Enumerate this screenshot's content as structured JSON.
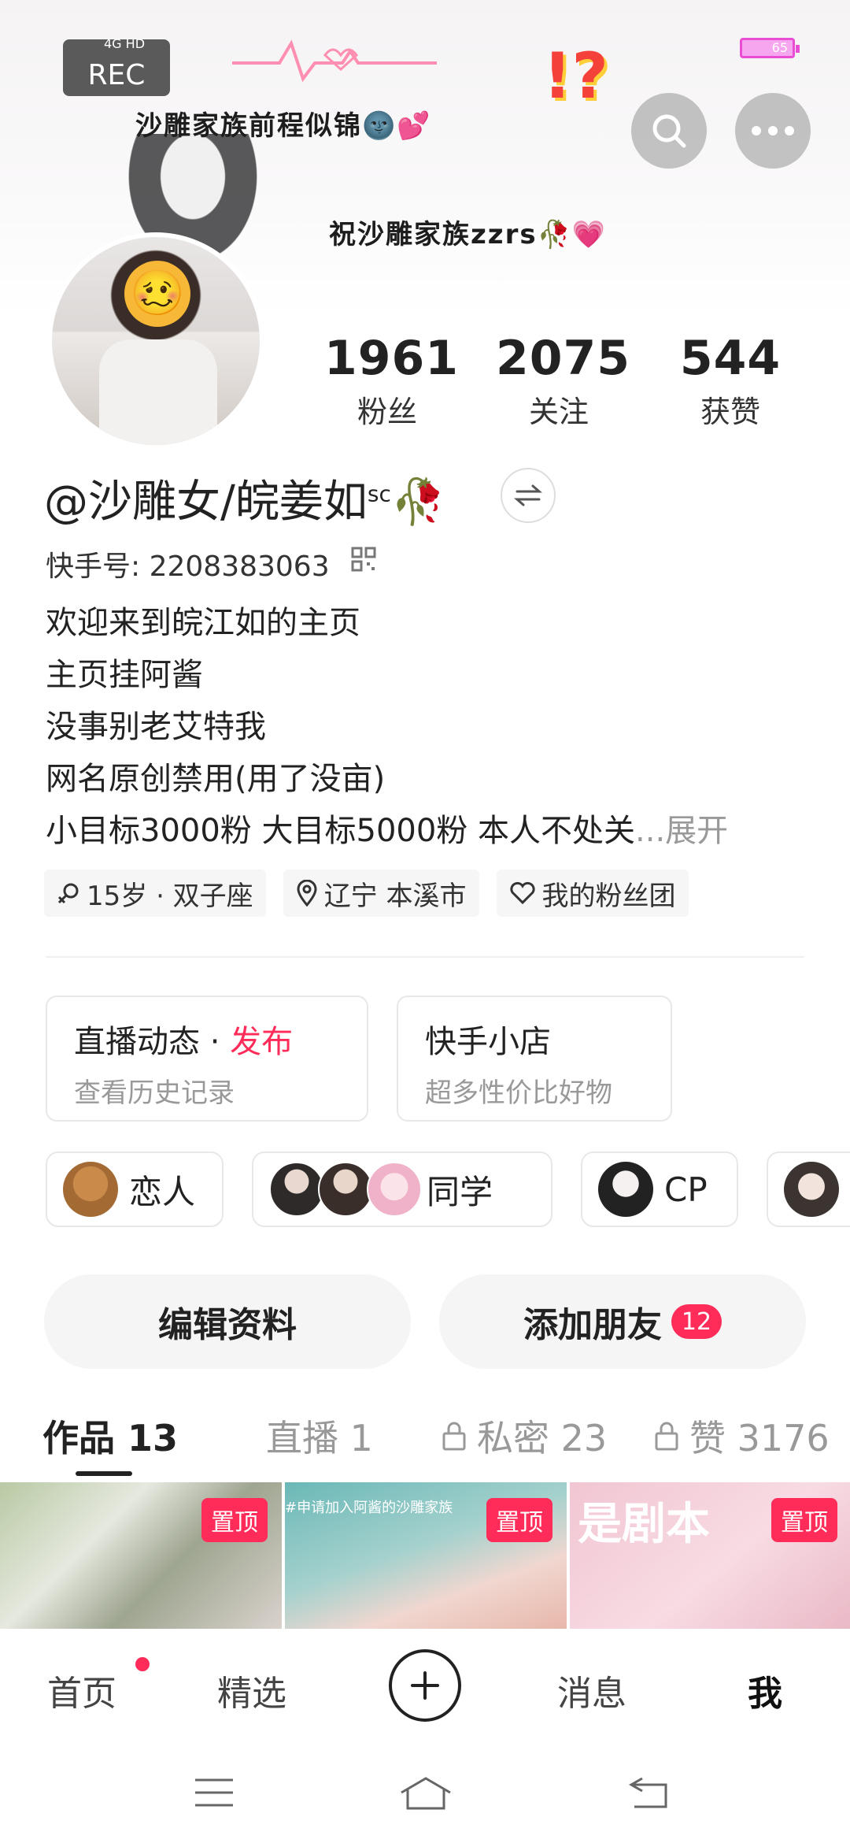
{
  "header": {
    "rec_label": "REC",
    "signal": "4G HD",
    "battery": "65",
    "banner_line1": "沙雕家族前程似锦🌚💕",
    "banner_line2": "祝沙雕家族zzrs🥀💗",
    "banner_emoji": "!?"
  },
  "stats": {
    "fans_num": "1961",
    "fans_label": "粉丝",
    "follow_num": "2075",
    "follow_label": "关注",
    "likes_num": "544",
    "likes_label": "获赞"
  },
  "profile": {
    "name": "@沙雕女/皖姜如",
    "name_sup": "sc",
    "name_emoji": "🥀",
    "kuaishou_id": "快手号: 2208383063",
    "bio_lines": [
      "欢迎来到皖江如的主页",
      "主页挂阿酱",
      "没事别老艾特我",
      "网名原创禁用(用了没亩)"
    ],
    "bio_last": "小目标3000粉 大目标5000粉 本人不处关",
    "bio_expand": "...展开",
    "tags": [
      "15岁 · 双子座",
      "辽宁 本溪市",
      "我的粉丝团"
    ]
  },
  "cards": {
    "live_title": "直播动态",
    "live_sep": " · ",
    "live_publish": "发布",
    "live_sub": "查看历史记录",
    "shop_title": "快手小店",
    "shop_sub": "超多性价比好物"
  },
  "relations": [
    {
      "label": "恋人"
    },
    {
      "label": "同学"
    },
    {
      "label": "CP"
    }
  ],
  "actions": {
    "edit": "编辑资料",
    "add_friend": "添加朋友",
    "add_friend_badge": "12"
  },
  "tabs": {
    "works": "作品 13",
    "live": "直播 1",
    "private": "私密 23",
    "likes": "赞 3176"
  },
  "grid": {
    "pin_label": "置顶",
    "thumb2_caption": "#申请加入阿酱的沙雕家族",
    "thumb3_caption": "是剧本"
  },
  "nav": {
    "home": "首页",
    "picks": "精选",
    "messages": "消息",
    "me": "我"
  },
  "colors": {
    "accent": "#ff2c5a",
    "text": "#222222",
    "muted": "#999999"
  }
}
